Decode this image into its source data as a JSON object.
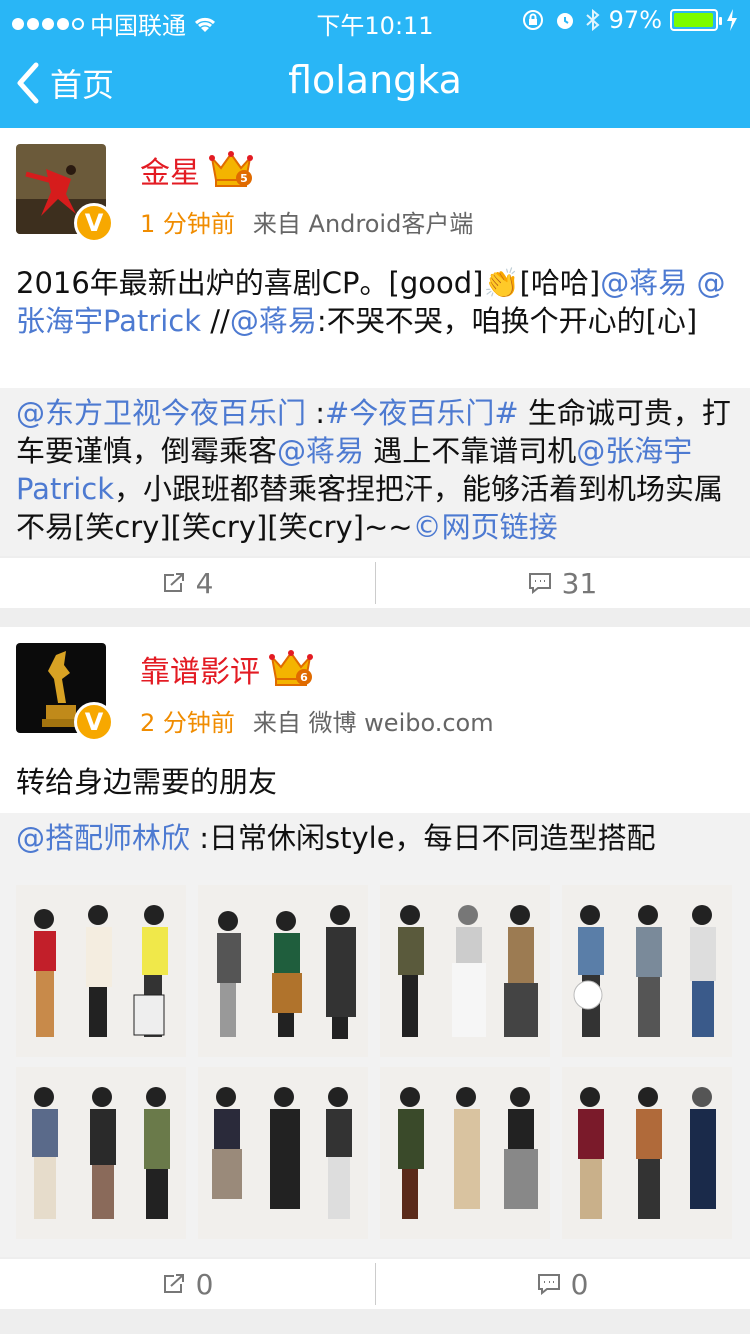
{
  "status": {
    "carrier": "中国联通",
    "time": "下午10:11",
    "battery": "97%",
    "battery_level": 0.97
  },
  "nav": {
    "back_label": "首页",
    "title": "flolangka"
  },
  "posts": [
    {
      "user": "金星",
      "rank": "5",
      "time": "1 分钟前",
      "source_prefix": "来自",
      "source": "Android客户端",
      "text_parts": [
        {
          "t": "2016年最新出炉的喜剧CP。[good]",
          "link": false
        },
        {
          "t": "👏",
          "link": false
        },
        {
          "t": "[哈哈]",
          "link": false
        },
        {
          "t": "@蒋易 @张海宇Patrick",
          "link": true
        },
        {
          "t": " //",
          "link": false
        },
        {
          "t": "@蒋易",
          "link": true
        },
        {
          "t": ":不哭不哭，咱换个开心的[心]",
          "link": false
        }
      ],
      "quote_parts": [
        {
          "t": "@东方卫视今夜百乐门",
          "link": true
        },
        {
          "t": " :",
          "link": false
        },
        {
          "t": "#今夜百乐门#",
          "link": true
        },
        {
          "t": " 生命诚可贵，打车要谨慎，倒霉乘客",
          "link": false
        },
        {
          "t": "@蒋易",
          "link": true
        },
        {
          "t": " 遇上不靠谱司机",
          "link": false
        },
        {
          "t": "@张海宇Patrick",
          "link": true
        },
        {
          "t": "，小跟班都替乘客捏把汗，能够活着到机场实属不易[笑cry][笑cry][笑cry]~~",
          "link": false
        },
        {
          "t": "©网页链接",
          "link": true
        }
      ],
      "reposts": "4",
      "comments": "31"
    },
    {
      "user": "靠谱影评",
      "rank": "6",
      "time": "2 分钟前",
      "source_prefix": "来自",
      "source": "微博 weibo.com",
      "text": "转给身边需要的朋友",
      "quote_parts": [
        {
          "t": "@搭配师林欣",
          "link": true
        },
        {
          "t": " :日常休闲style，每日不同造型搭配",
          "link": false
        }
      ],
      "reposts": "0",
      "comments": "0"
    }
  ],
  "badges": {
    "v": "V"
  },
  "colors": {
    "header": "#29b6f6",
    "link": "#4d7ad1",
    "username": "#e31b23",
    "time": "#f08c00",
    "badge": "#f7a800"
  },
  "icons": [
    "back-chevron-icon",
    "wifi-icon",
    "lock-rotation-icon",
    "alarm-icon",
    "bluetooth-icon",
    "battery-icon",
    "crown-icon",
    "verified-badge-icon",
    "repost-icon",
    "comment-icon"
  ]
}
